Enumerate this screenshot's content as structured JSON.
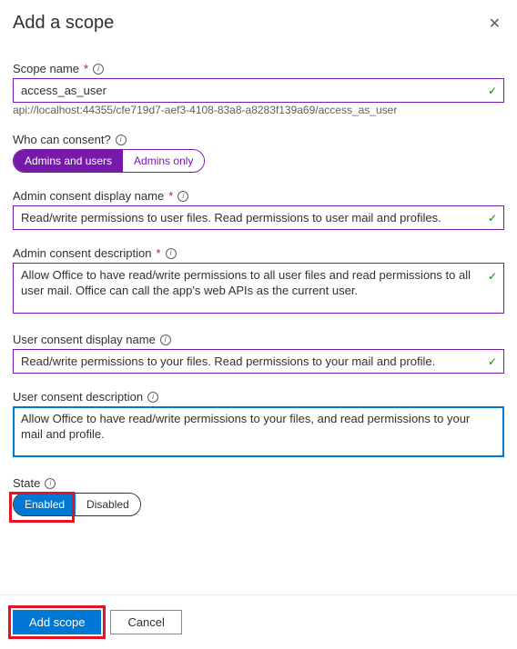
{
  "header": {
    "title": "Add a scope"
  },
  "scope_name": {
    "label": "Scope name",
    "value": "access_as_user",
    "hint": "api://localhost:44355/cfe719d7-aef3-4108-83a8-a8283f139a69/access_as_user"
  },
  "who_can_consent": {
    "label": "Who can consent?",
    "options": {
      "a": "Admins and users",
      "b": "Admins only"
    },
    "selected": "a"
  },
  "admin_display": {
    "label": "Admin consent display name",
    "value": "Read/write permissions to user files. Read permissions to user mail and profiles."
  },
  "admin_desc": {
    "label": "Admin consent description",
    "value": "Allow Office to have read/write permissions to all user files and read permissions to all user mail. Office can call the app's web APIs as the current user."
  },
  "user_display": {
    "label": "User consent display name",
    "value": "Read/write permissions to your files. Read permissions to your mail and profile."
  },
  "user_desc": {
    "label": "User consent description",
    "value": "Allow Office to have read/write permissions to your files, and read permissions to your mail and profile."
  },
  "state": {
    "label": "State",
    "options": {
      "a": "Enabled",
      "b": "Disabled"
    },
    "selected": "a"
  },
  "footer": {
    "add": "Add scope",
    "cancel": "Cancel"
  }
}
